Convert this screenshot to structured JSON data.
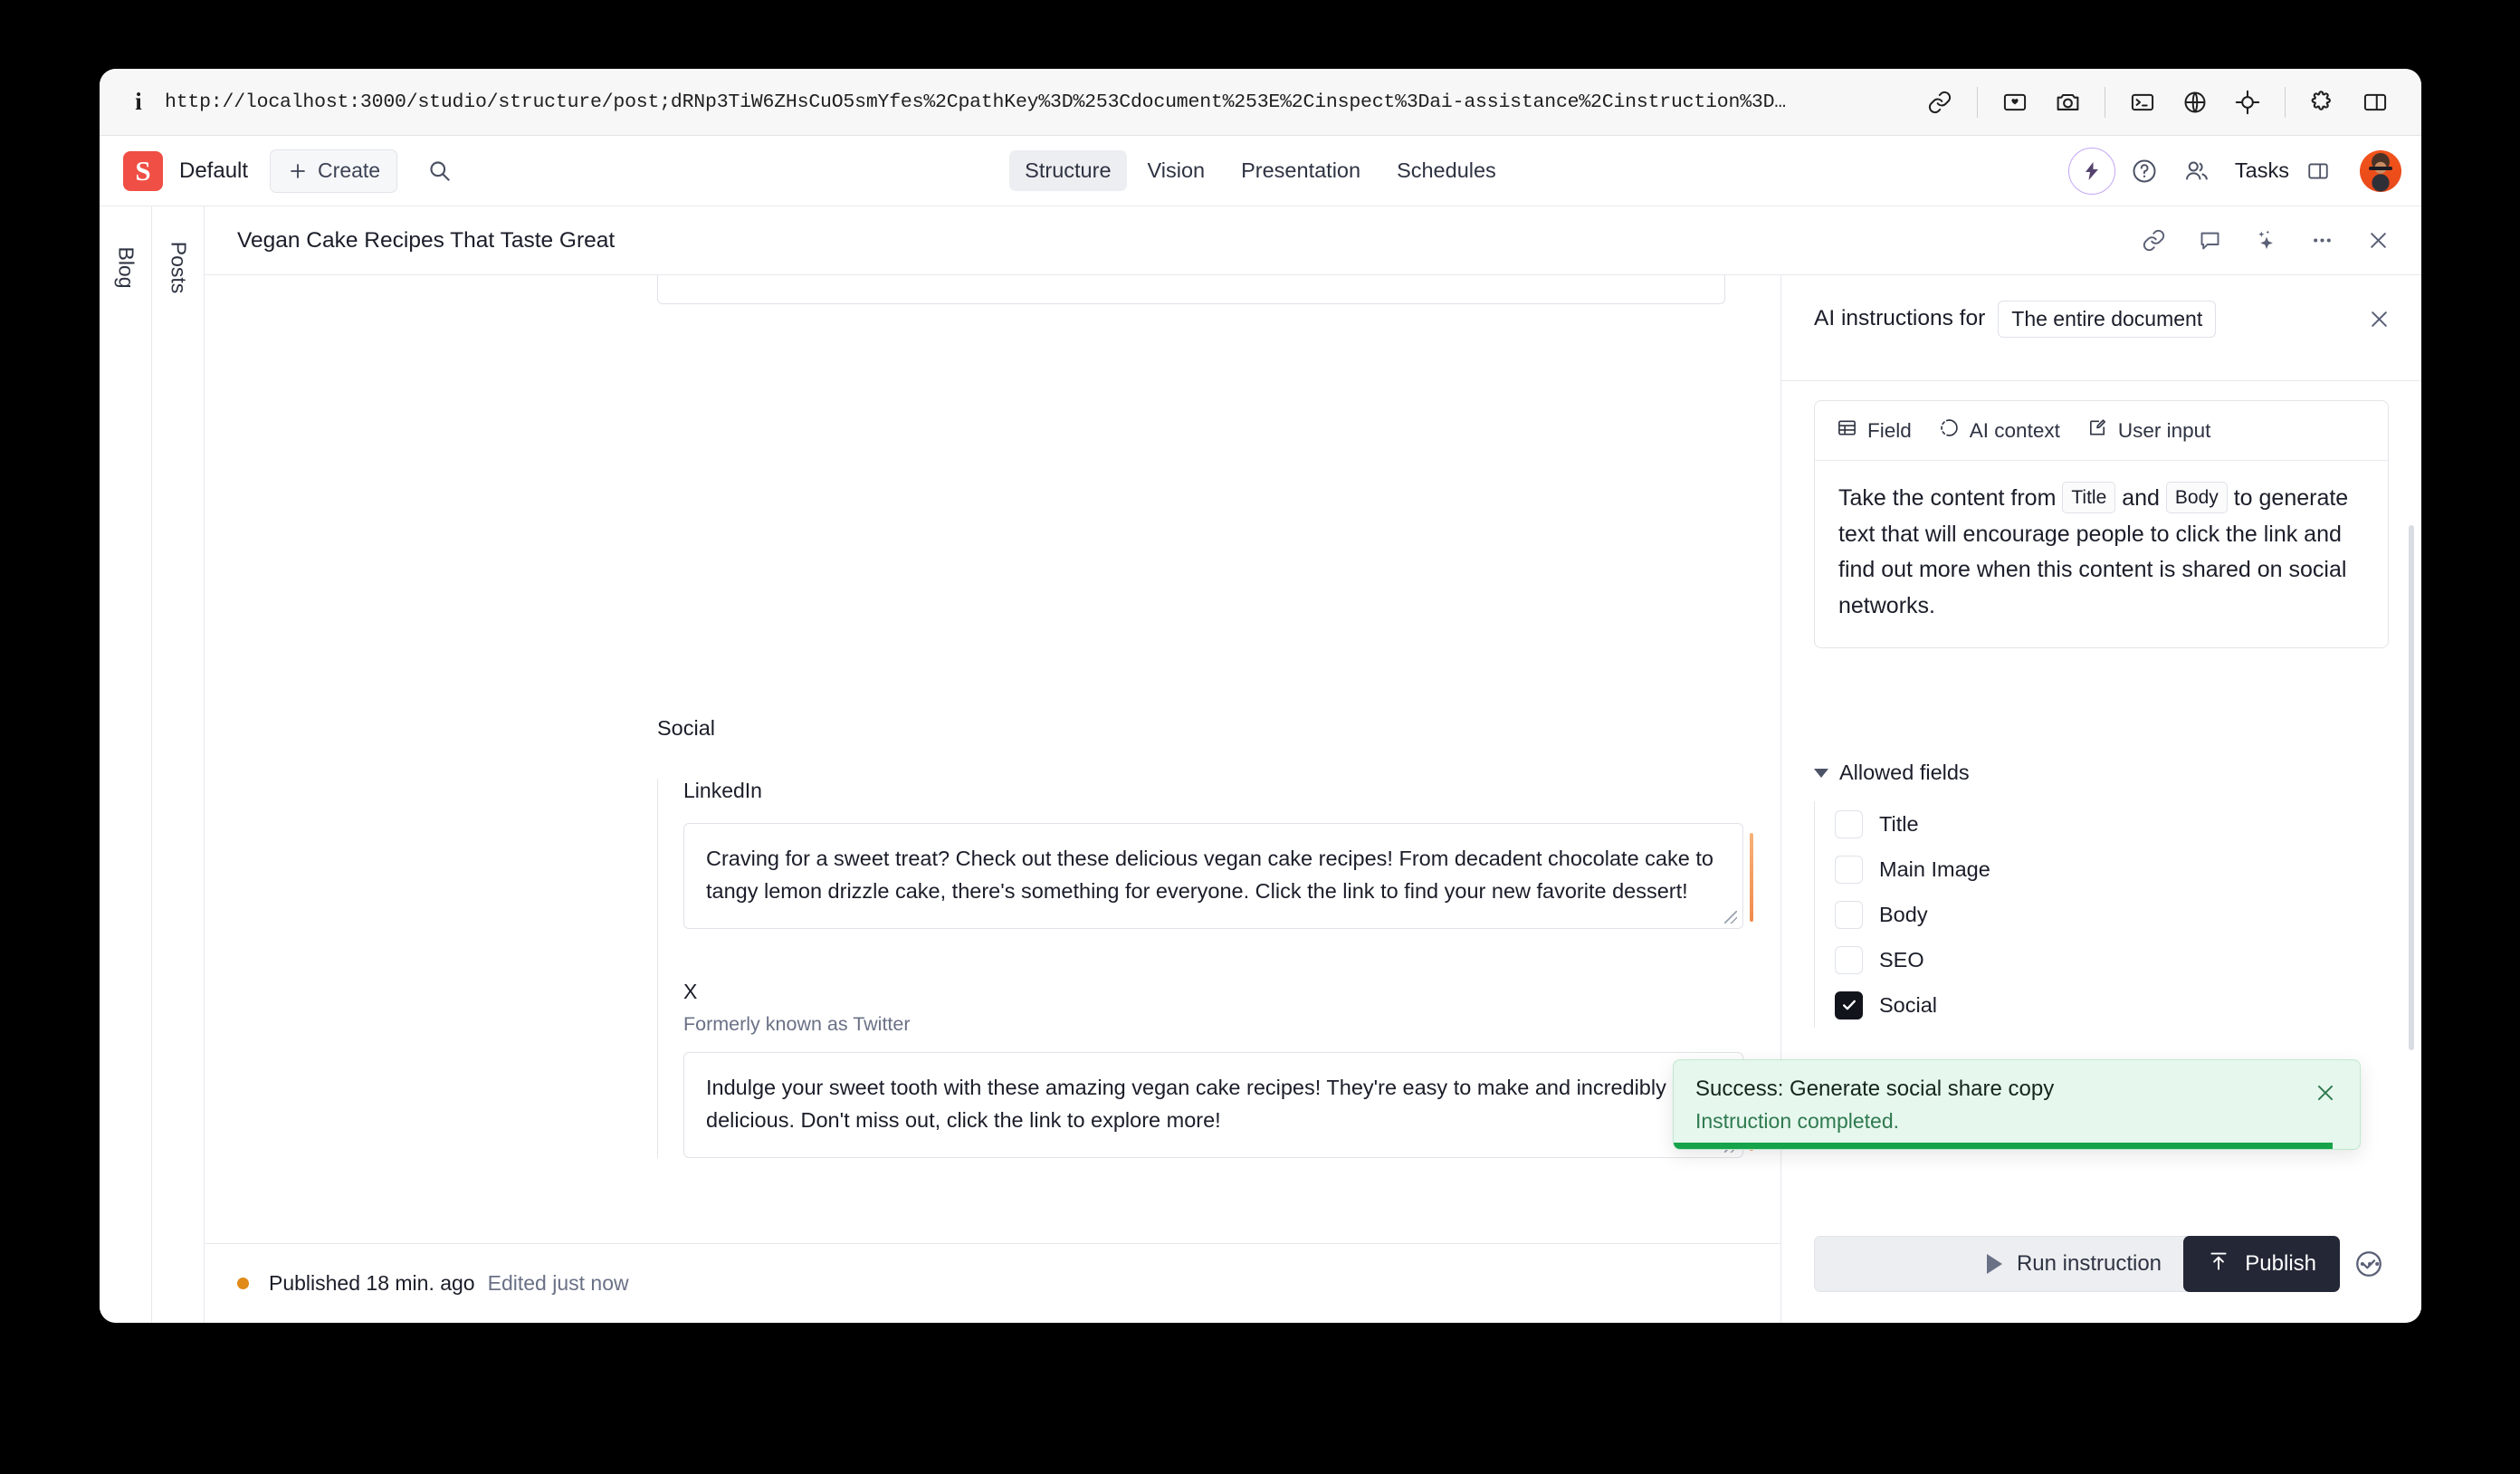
{
  "browser": {
    "url": "http://localhost:3000/studio/structure/post;dRNp3TiW6ZHsCuO5smYfes%2CpathKey%3D%253Cdocument%253E%2Cinspect%3Dai-assistance%2Cinstruction%3D…",
    "info_icon": "info-icon",
    "toolbar_icons": [
      {
        "name": "link-icon"
      },
      {
        "name": "image-placeholder-icon"
      },
      {
        "name": "camera-icon"
      },
      {
        "name": "terminal-icon"
      },
      {
        "name": "globe-icon"
      },
      {
        "name": "crosshair-icon"
      },
      {
        "name": "puzzle-extension-icon"
      },
      {
        "name": "split-panel-icon"
      }
    ]
  },
  "studio_nav": {
    "logo_letter": "S",
    "logo_color": "#f04a3f",
    "workspace": "Default",
    "create_label": "Create",
    "search_icon": "search-icon",
    "tabs": [
      {
        "label": "Structure",
        "active": true
      },
      {
        "label": "Vision",
        "active": false
      },
      {
        "label": "Presentation",
        "active": false
      },
      {
        "label": "Schedules",
        "active": false
      }
    ],
    "right_icons": [
      {
        "name": "ai-assist-icon"
      },
      {
        "name": "help-icon"
      },
      {
        "name": "presence-users-icon"
      }
    ],
    "tasks_label": "Tasks",
    "tasks_panel_icon": "panel-icon",
    "avatar": "user-avatar"
  },
  "panes": {
    "rail_1_label": "Blog",
    "rail_2_label": "Posts"
  },
  "document": {
    "title": "Vegan Cake Recipes That Taste Great",
    "header_icons": [
      {
        "name": "link-icon"
      },
      {
        "name": "comment-icon"
      },
      {
        "name": "sparkles-ai-icon"
      },
      {
        "name": "more-options-icon"
      },
      {
        "name": "close-icon"
      }
    ],
    "group_label": "Social",
    "fields": [
      {
        "label": "LinkedIn",
        "description": "",
        "value": "Craving for a sweet treat? Check out these delicious vegan cake recipes! From decadent chocolate cake to tangy lemon drizzle cake, there's something for everyone. Click the link to find your new favorite dessert!"
      },
      {
        "label": "X",
        "description": "Formerly known as Twitter",
        "value": "Indulge your sweet tooth with these amazing vegan cake recipes! They're easy to make and incredibly delicious. Don't miss out, click the link to explore more!"
      }
    ],
    "footer": {
      "status": "Published 18 min. ago",
      "edited": "Edited just now",
      "status_dot_color": "#e08a19",
      "publish_label": "Publish",
      "publish_icon": "publish-up-arrow-icon",
      "more_label": "…"
    }
  },
  "inspector": {
    "title": "AI instructions for",
    "scope_chip": "The entire document",
    "close_icon": "close-icon",
    "toolbar": [
      {
        "label": "Field",
        "icon": "field-table-icon"
      },
      {
        "label": "AI context",
        "icon": "ai-context-icon"
      },
      {
        "label": "User input",
        "icon": "user-input-pencil-icon"
      }
    ],
    "prompt": {
      "part1": "Take the content from",
      "token1": "Title",
      "part2": "and",
      "token2": "Body",
      "part3": "to generate text that will encourage people to click the link and find out more when this content is shared on social networks."
    },
    "allowed_fields_label": "Allowed fields",
    "allowed_fields": [
      {
        "label": "Title",
        "checked": false
      },
      {
        "label": "Main Image",
        "checked": false
      },
      {
        "label": "Body",
        "checked": false
      },
      {
        "label": "SEO",
        "checked": false
      },
      {
        "label": "Social",
        "checked": true
      }
    ],
    "run_label": "Run instruction",
    "run_icon": "play-icon",
    "run_status_icon": "check-circle-icon"
  },
  "toast": {
    "title": "Success: Generate social share copy",
    "subtitle": "Instruction completed.",
    "close_icon": "close-icon",
    "accent_color": "#16a34a",
    "background_color": "#e6f7ed"
  }
}
